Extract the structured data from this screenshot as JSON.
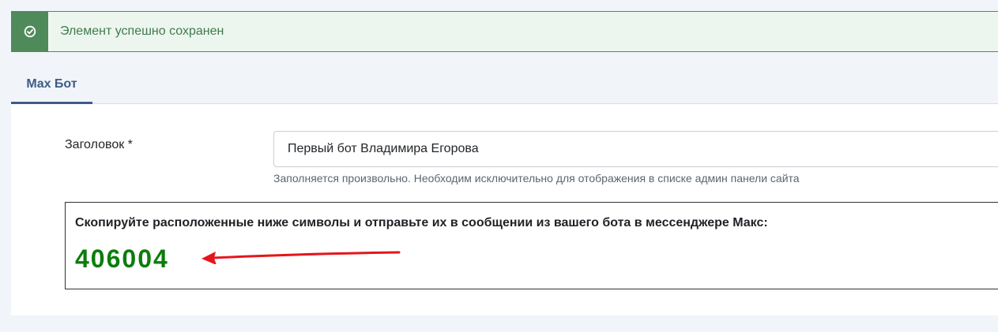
{
  "alert": {
    "icon": "check-circle-icon",
    "message": "Элемент успешно сохранен",
    "color": "#4f8a5b"
  },
  "tabs": [
    {
      "label": "Max Бот",
      "active": true
    }
  ],
  "form": {
    "title_label": "Заголовок *",
    "title_value": "Первый бот Владимира Егорова",
    "title_hint": "Заполняется произвольно. Необходим исключительно для отображения в списке админ панели сайта"
  },
  "code_box": {
    "instruction": "Скопируйте расположенные ниже символы и отправьте их в сообщении из вашего бота в мессенджере Макс:",
    "code": "406004",
    "code_color": "#0b7d0b",
    "annotation": "red-arrow-icon"
  }
}
